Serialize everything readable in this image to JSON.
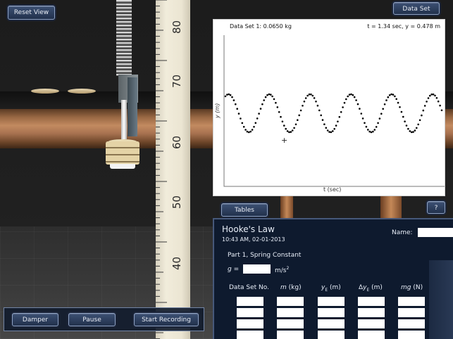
{
  "scene": {
    "ruler_marks": [
      "80",
      "70",
      "60",
      "50",
      "40"
    ],
    "reset_view_label": "Reset View",
    "data_set_label": "Data Set"
  },
  "graph": {
    "header_left": "Data Set 1: 0.0650 kg",
    "header_right": "t = 1.34 sec, y = 0.478 m",
    "y_axis_label": "y (m)",
    "x_axis_label": "t (sec)",
    "cursor_marker": "+"
  },
  "chart_data": {
    "type": "scatter",
    "xlabel": "t (sec)",
    "ylabel": "y (m)",
    "series": [
      {
        "points": "oscillation",
        "periods_shown": 5.3,
        "amplitude_relative": 1.0,
        "marker": "dot",
        "color": "#000000"
      }
    ],
    "grid": false,
    "legend": "none"
  },
  "buttons": {
    "tables_label": "Tables",
    "help_label": "?",
    "damper_label": "Damper",
    "pause_label": "Pause",
    "start_recording_label": "Start Recording"
  },
  "notebook": {
    "title": "Hooke's Law",
    "date": "10:43 AM, 02-01-2013",
    "name_label": "Name:",
    "name_value": "",
    "part_title": "Part 1, Spring Constant",
    "g_label": "g =",
    "g_value": "",
    "g_unit": "m/s",
    "g_unit_exponent": "2",
    "columns": [
      {
        "label": "Data Set No."
      },
      {
        "label": "m (kg)"
      },
      {
        "label": "yE (m)"
      },
      {
        "label": "ΔyE (m)"
      },
      {
        "label": "mg (N)"
      }
    ]
  },
  "colors": {
    "button_bg": "#2c3d5e",
    "button_border": "#8ea2c4",
    "notebook_bg": "#0e1a2e",
    "graph_bg": "#ffffff"
  }
}
